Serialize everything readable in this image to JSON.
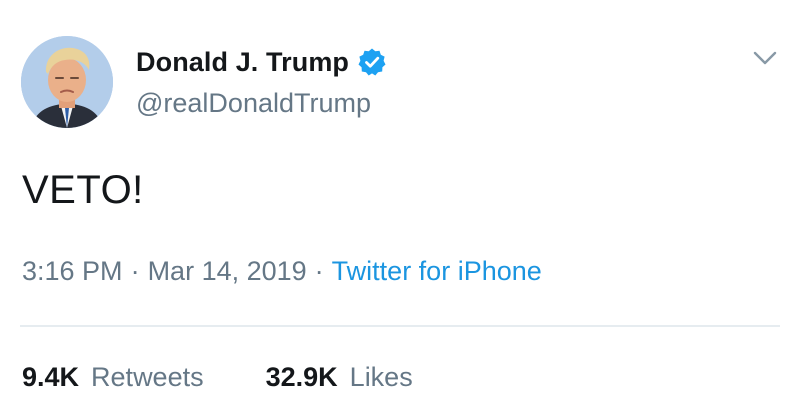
{
  "tweet": {
    "author": {
      "display_name": "Donald J. Trump",
      "handle": "@realDonaldTrump",
      "verified": true,
      "verified_color": "#1da1f2",
      "avatar_icon": "profile-photo"
    },
    "text": "VETO!",
    "meta": {
      "time": "3:16 PM",
      "separator": "·",
      "date": "Mar 14, 2019",
      "source": "Twitter for iPhone",
      "source_color": "#1b95e0"
    },
    "stats": {
      "retweets_count": "9.4K",
      "retweets_label": "Retweets",
      "likes_count": "32.9K",
      "likes_label": "Likes"
    },
    "menu_icon": "chevron-down"
  }
}
